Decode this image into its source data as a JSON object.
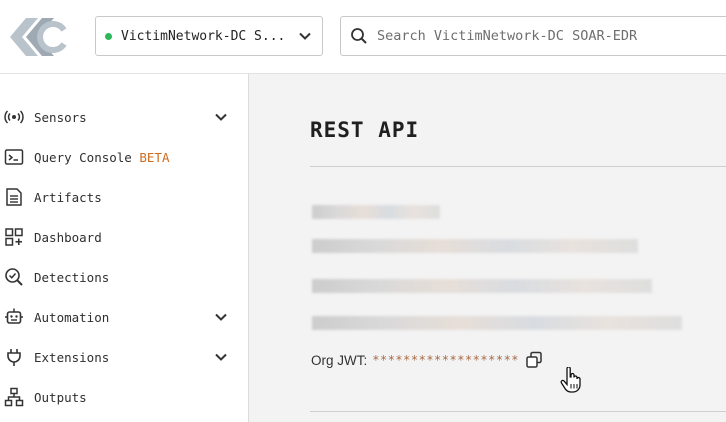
{
  "header": {
    "org_selector": {
      "value": "VictimNetwork-DC S...",
      "status_color": "#2eb65a"
    },
    "search": {
      "placeholder": "Search VictimNetwork-DC SOAR-EDR"
    }
  },
  "sidebar": {
    "items": [
      {
        "label": "Sensors",
        "icon": "sensor-broadcast-icon",
        "expandable": true
      },
      {
        "label": "Query Console",
        "badge": "BETA",
        "icon": "terminal-icon",
        "expandable": false
      },
      {
        "label": "Artifacts",
        "icon": "document-icon",
        "expandable": false
      },
      {
        "label": "Dashboard",
        "icon": "dashboard-grid-icon",
        "expandable": false
      },
      {
        "label": "Detections",
        "icon": "magnifier-check-icon",
        "expandable": false
      },
      {
        "label": "Automation",
        "icon": "robot-icon",
        "expandable": true
      },
      {
        "label": "Extensions",
        "icon": "plug-icon",
        "expandable": true
      },
      {
        "label": "Outputs",
        "icon": "network-tree-icon",
        "expandable": false
      }
    ]
  },
  "main": {
    "title": "REST API",
    "org_jwt": {
      "label": "Org JWT:",
      "value": "*******************"
    }
  },
  "colors": {
    "badge": "#d16b1f",
    "jwt_value": "#a66a47"
  }
}
